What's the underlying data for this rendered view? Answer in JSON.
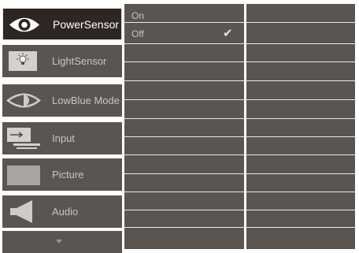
{
  "menu": {
    "items": [
      {
        "label": "PowerSensor",
        "icon": "eye-icon",
        "active": true
      },
      {
        "label": "LightSensor",
        "icon": "light-bulb-icon",
        "active": false
      },
      {
        "label": "LowBlue Mode",
        "icon": "lowblue-eye-icon",
        "active": false
      },
      {
        "label": "Input",
        "icon": "input-icon",
        "active": false
      },
      {
        "label": "Picture",
        "icon": "picture-icon",
        "active": false
      },
      {
        "label": "Audio",
        "icon": "speaker-icon",
        "active": false
      }
    ],
    "more_icon": "chevron-down-icon"
  },
  "submenu": {
    "options": [
      {
        "label": "On",
        "selected": false
      },
      {
        "label": "Off",
        "selected": true
      }
    ],
    "check_glyph": "✔"
  },
  "colors": {
    "panel": "#5b5551",
    "active_bg": "#2e2622",
    "text": "#c9c5c1",
    "active_text": "#ffffff",
    "separator": "#e9e9e9"
  }
}
